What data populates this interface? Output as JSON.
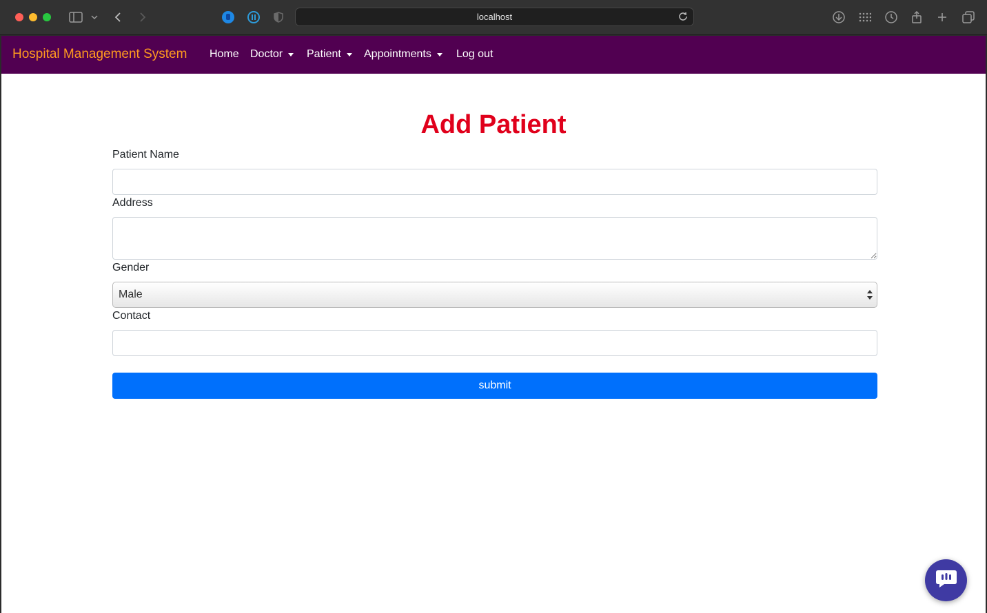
{
  "browser": {
    "url": "localhost",
    "icons": [
      "sidebar-icon",
      "chevron-down-icon",
      "back-icon",
      "forward-icon",
      "hand-extension-icon",
      "pause-extension-icon",
      "shield-icon",
      "reload-icon",
      "download-icon",
      "grid-icon",
      "history-icon",
      "share-icon",
      "new-tab-icon",
      "tabs-overview-icon"
    ]
  },
  "navbar": {
    "brand": "Hospital Management System",
    "brand_color": "#ff9a1f",
    "background": "#510051",
    "links": [
      {
        "label": "Home",
        "dropdown": false
      },
      {
        "label": "Doctor",
        "dropdown": true
      },
      {
        "label": "Patient",
        "dropdown": true
      },
      {
        "label": "Appointments",
        "dropdown": true
      },
      {
        "label": "Log out",
        "dropdown": false
      }
    ]
  },
  "form": {
    "title": "Add Patient",
    "title_color": "#e0001b",
    "fields": {
      "name_label": "Patient Name",
      "name_value": "",
      "address_label": "Address",
      "address_value": "",
      "gender_label": "Gender",
      "gender_value": "Male",
      "contact_label": "Contact",
      "contact_value": ""
    },
    "submit_label": "submit",
    "submit_color": "#0070fc"
  },
  "chat_widget": {
    "icon": "chat-icon",
    "color": "#3f3aa3"
  }
}
